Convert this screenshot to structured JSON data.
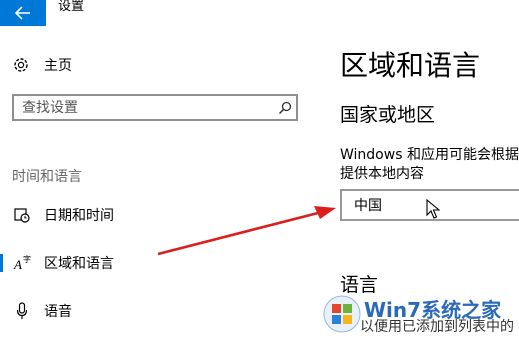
{
  "window": {
    "title": "设置"
  },
  "sidebar": {
    "home_label": "主页",
    "search_placeholder": "查找设置",
    "group_header": "时间和语言",
    "items": [
      {
        "label": "日期和时间",
        "icon": "clock-calendar-icon"
      },
      {
        "label": "区域和语言",
        "icon": "region-language-icon",
        "selected": true
      },
      {
        "label": "语音",
        "icon": "microphone-icon"
      }
    ]
  },
  "main": {
    "title": "区域和语言",
    "country_section": {
      "title": "国家或地区",
      "desc_line1": "Windows 和应用可能会根据",
      "desc_line2": "提供本地内容",
      "selected": "中国"
    },
    "language_section": {
      "title": "语言",
      "desc": "以便用已添加到列表中的"
    }
  },
  "watermark": {
    "text": "Win7系统之家"
  },
  "colors": {
    "accent": "#0078d7",
    "annotation_arrow": "#d9201c"
  }
}
